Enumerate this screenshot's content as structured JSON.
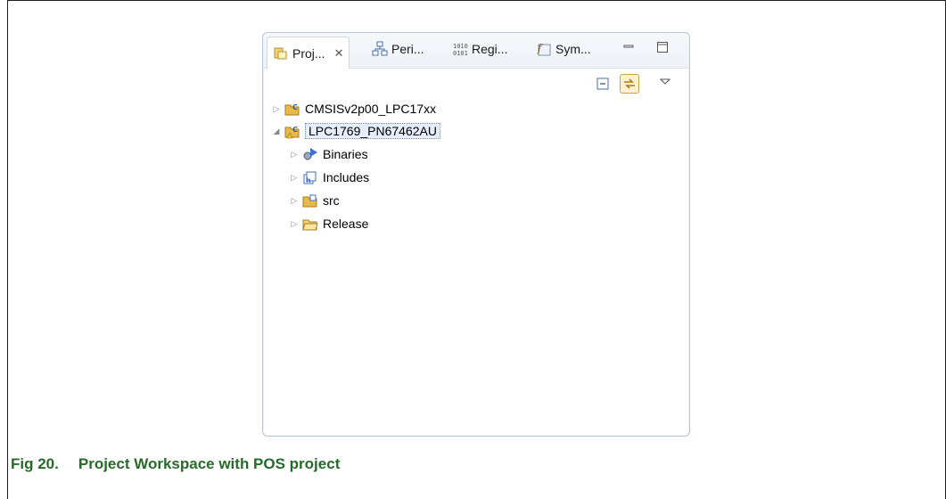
{
  "tabs": [
    {
      "label": "Proj...",
      "icon": "project-explorer-icon",
      "active": true
    },
    {
      "label": "Peri...",
      "icon": "peripherals-icon"
    },
    {
      "label": "Regi...",
      "icon": "registers-icon"
    },
    {
      "label": "Sym...",
      "icon": "symbol-viewer-icon"
    }
  ],
  "close_glyph": "✕",
  "tree": {
    "projects": [
      {
        "label": "CMSISv2p00_LPC17xx",
        "expanded": false
      },
      {
        "label": "LPC1769_PN67462AU",
        "expanded": true,
        "selected": true,
        "children": [
          {
            "label": "Binaries"
          },
          {
            "label": "Includes"
          },
          {
            "label": "src"
          },
          {
            "label": "Release"
          }
        ]
      }
    ]
  },
  "caption": {
    "number": "Fig 20.",
    "text": "Project Workspace with POS project"
  },
  "colors": {
    "caption": "#276a2a",
    "folder": "#e8b84a",
    "selection": "#e6eefb"
  }
}
